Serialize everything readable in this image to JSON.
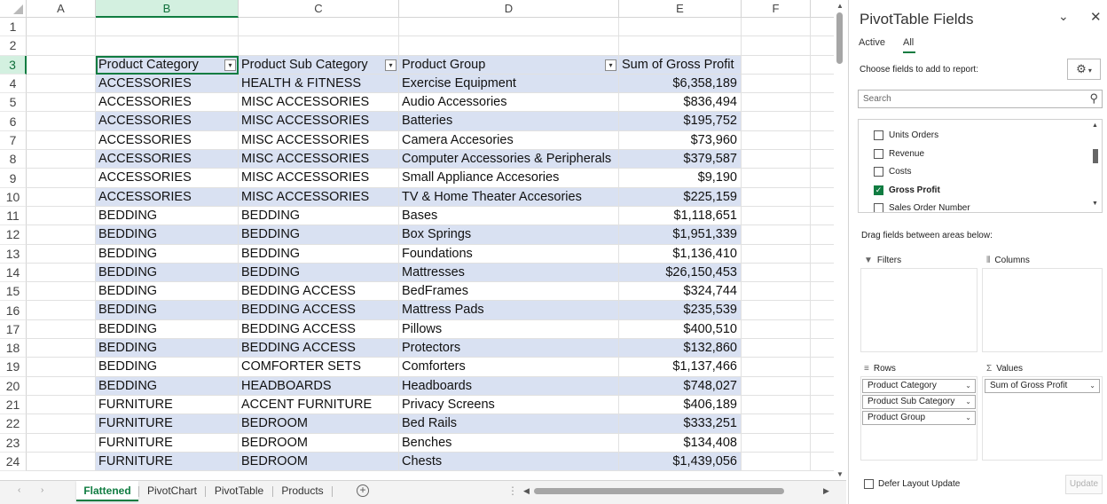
{
  "sheet": {
    "columns": [
      "A",
      "B",
      "C",
      "D",
      "E",
      "F"
    ],
    "rows": [
      "1",
      "2",
      "3",
      "4",
      "5",
      "6",
      "7",
      "8",
      "9",
      "10",
      "11",
      "12",
      "13",
      "14",
      "15",
      "16",
      "17",
      "18",
      "19",
      "20",
      "21",
      "22",
      "23",
      "24"
    ],
    "pivot_headers": [
      "Product Category",
      "Product Sub Category",
      "Product Group",
      "Sum of Gross Profit"
    ],
    "data_rows": [
      [
        "ACCESSORIES",
        "HEALTH & FITNESS",
        "Exercise Equipment",
        "$6,358,189"
      ],
      [
        "ACCESSORIES",
        "MISC ACCESSORIES",
        "Audio Accessories",
        "$836,494"
      ],
      [
        "ACCESSORIES",
        "MISC ACCESSORIES",
        "Batteries",
        "$195,752"
      ],
      [
        "ACCESSORIES",
        "MISC ACCESSORIES",
        "Camera Accesories",
        "$73,960"
      ],
      [
        "ACCESSORIES",
        "MISC ACCESSORIES",
        "Computer Accessories & Peripherals",
        "$379,587"
      ],
      [
        "ACCESSORIES",
        "MISC ACCESSORIES",
        "Small Appliance Accesories",
        "$9,190"
      ],
      [
        "ACCESSORIES",
        "MISC ACCESSORIES",
        "TV & Home Theater Accesories",
        "$225,159"
      ],
      [
        "BEDDING",
        "BEDDING",
        "Bases",
        "$1,118,651"
      ],
      [
        "BEDDING",
        "BEDDING",
        "Box Springs",
        "$1,951,339"
      ],
      [
        "BEDDING",
        "BEDDING",
        "Foundations",
        "$1,136,410"
      ],
      [
        "BEDDING",
        "BEDDING",
        "Mattresses",
        "$26,150,453"
      ],
      [
        "BEDDING",
        "BEDDING ACCESS",
        "BedFrames",
        "$324,744"
      ],
      [
        "BEDDING",
        "BEDDING ACCESS",
        "Mattress Pads",
        "$235,539"
      ],
      [
        "BEDDING",
        "BEDDING ACCESS",
        "Pillows",
        "$400,510"
      ],
      [
        "BEDDING",
        "BEDDING ACCESS",
        "Protectors",
        "$132,860"
      ],
      [
        "BEDDING",
        "COMFORTER SETS",
        "Comforters",
        "$1,137,466"
      ],
      [
        "BEDDING",
        "HEADBOARDS",
        "Headboards",
        "$748,027"
      ],
      [
        "FURNITURE",
        "ACCENT FURNITURE",
        "Privacy Screens",
        "$406,189"
      ],
      [
        "FURNITURE",
        "BEDROOM",
        "Bed Rails",
        "$333,251"
      ],
      [
        "FURNITURE",
        "BEDROOM",
        "Benches",
        "$134,408"
      ],
      [
        "FURNITURE",
        "BEDROOM",
        "Chests",
        "$1,439,056"
      ]
    ],
    "tabs": [
      "Flattened",
      "PivotChart",
      "PivotTable",
      "Products"
    ],
    "active_tab": "Flattened",
    "selected_column": "B",
    "selected_row": "3"
  },
  "pane": {
    "title": "PivotTable Fields",
    "tab_active": "Active",
    "tab_all": "All",
    "choose_label": "Choose fields to add to report:",
    "search_placeholder": "Search",
    "fields": [
      {
        "label": "Units Orders",
        "checked": false
      },
      {
        "label": "Revenue",
        "checked": false
      },
      {
        "label": "Costs",
        "checked": false
      },
      {
        "label": "Gross Profit",
        "checked": true
      },
      {
        "label": "Sales Order Number",
        "checked": false
      }
    ],
    "drag_label": "Drag fields between areas below:",
    "areas": {
      "filters": "Filters",
      "columns": "Columns",
      "rows": "Rows",
      "values": "Values"
    },
    "rows_fields": [
      "Product Category",
      "Product Sub Category",
      "Product Group"
    ],
    "values_fields": [
      "Sum of Gross Profit"
    ],
    "defer_label": "Defer Layout Update",
    "update_label": "Update"
  }
}
